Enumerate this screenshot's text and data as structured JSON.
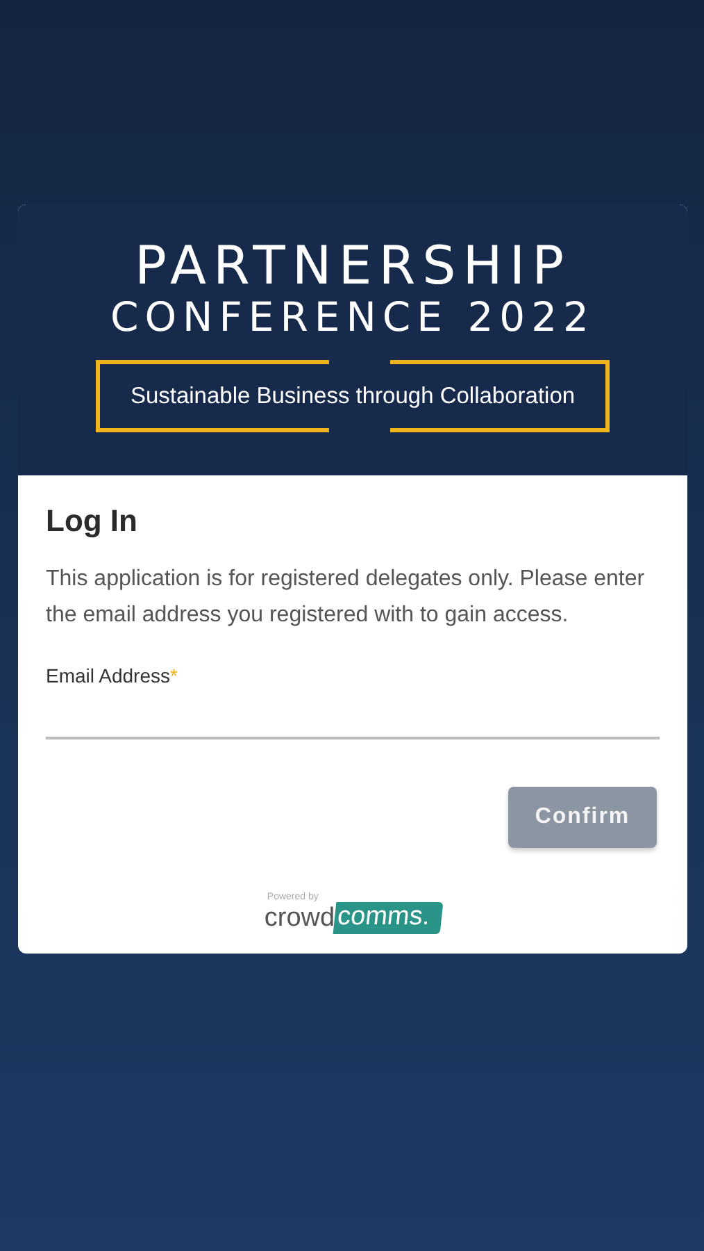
{
  "banner": {
    "title": "PARTNERSHIP",
    "subtitle": "CONFERENCE 2022",
    "tagline": "Sustainable Business through Collaboration"
  },
  "login": {
    "heading": "Log In",
    "description": "This application is for registered delegates only. Please enter the email address you registered with to gain access.",
    "email_field": {
      "label": "Email Address",
      "required_mark": "*",
      "required": true
    },
    "confirm_button": {
      "label": "Confirm",
      "disabled": true
    }
  },
  "footer": {
    "powered_by": "Powered by",
    "brand_left": "crowd",
    "brand_right": "comms."
  }
}
